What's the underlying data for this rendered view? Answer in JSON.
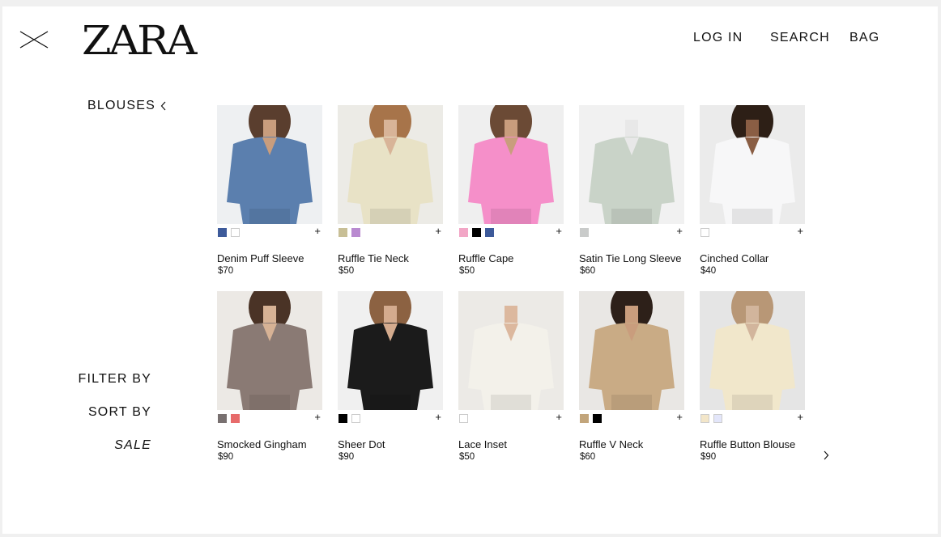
{
  "header": {
    "logo_text": "ZARA",
    "nav": {
      "login": "LOG IN",
      "search": "SEARCH",
      "bag": "BAG"
    }
  },
  "sidebar": {
    "category": "BLOUSES",
    "filter": "FILTER BY",
    "sort": "SORT BY",
    "sale": "SALE"
  },
  "products": [
    {
      "name": "Denim Puff Sleeve",
      "price": "$70",
      "colors": [
        "#3d5a9a",
        "#ffffff"
      ],
      "bg": "#eef0f2",
      "garment": "#5b7fae",
      "skin": "#c99d7d",
      "hair": "#5a3e2e"
    },
    {
      "name": "Ruffle Tie Neck",
      "price": "$50",
      "colors": [
        "#c8bf96",
        "#b98ad0"
      ],
      "bg": "#ecebe6",
      "garment": "#e8e2c6",
      "skin": "#d8b498",
      "hair": "#a7744a"
    },
    {
      "name": "Ruffle Cape",
      "price": "$50",
      "colors": [
        "#f2a6c6",
        "#000000",
        "#3d5a9a"
      ],
      "bg": "#efefef",
      "garment": "#f58fc9",
      "skin": "#c99d7d",
      "hair": "#6b4a35"
    },
    {
      "name": "Satin Tie Long Sleeve",
      "price": "$60",
      "colors": [
        "#c9cbca"
      ],
      "bg": "#f1f1f1",
      "garment": "#c9d3c8",
      "skin": "#e8e8e8",
      "hair": "#f1f1f1"
    },
    {
      "name": "Cinched Collar",
      "price": "$40",
      "colors": [
        "#ffffff"
      ],
      "bg": "#ebebeb",
      "garment": "#f7f7f8",
      "skin": "#8a5e44",
      "hair": "#2d1f16"
    },
    {
      "name": "Smocked Gingham",
      "price": "$90",
      "colors": [
        "#787070",
        "#e76b6b"
      ],
      "bg": "#ece9e5",
      "garment": "#8a7a74",
      "skin": "#d7b295",
      "hair": "#4a3326"
    },
    {
      "name": "Sheer Dot",
      "price": "$90",
      "colors": [
        "#000000",
        "#ffffff"
      ],
      "bg": "#f0f0f0",
      "garment": "#1b1b1b",
      "skin": "#d4ab8e",
      "hair": "#8c6242"
    },
    {
      "name": "Lace Inset",
      "price": "$50",
      "colors": [
        "#ffffff"
      ],
      "bg": "#eceae6",
      "garment": "#f3f1ea",
      "skin": "#dcb89e",
      "hair": "#eceae6"
    },
    {
      "name": "Ruffle V Neck",
      "price": "$60",
      "colors": [
        "#c2a57b",
        "#000000"
      ],
      "bg": "#e9e7e4",
      "garment": "#c9ab85",
      "skin": "#c99d7d",
      "hair": "#2d2019"
    },
    {
      "name": "Ruffle Button Blouse",
      "price": "$90",
      "colors": [
        "#f3e6c9",
        "#e3e6fa"
      ],
      "bg": "#e5e5e5",
      "garment": "#f1e7cb",
      "skin": "#d2b59c",
      "hair": "#b89776"
    }
  ],
  "icons": {
    "close": "close-icon",
    "back_chevron": "chevron-left-icon",
    "add": "plus-icon",
    "next": "chevron-right-icon"
  },
  "add_symbol": "+"
}
